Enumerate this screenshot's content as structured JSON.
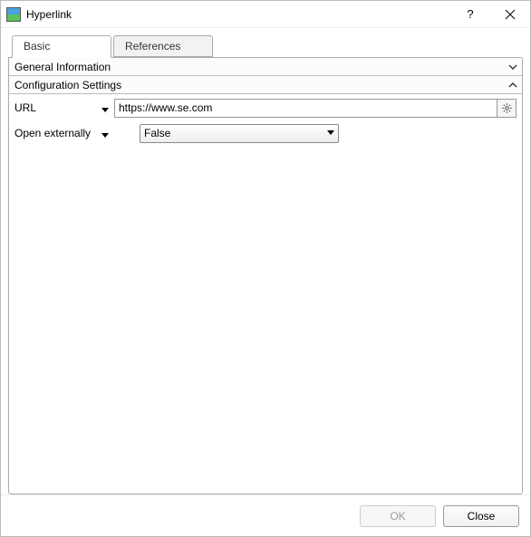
{
  "window": {
    "title": "Hyperlink"
  },
  "tabs": {
    "basic": "Basic",
    "references": "References"
  },
  "sections": {
    "general": "General Information",
    "config": "Configuration Settings"
  },
  "fields": {
    "url_label": "URL",
    "url_value": "https://www.se.com",
    "open_ext_label": "Open externally",
    "open_ext_value": "False"
  },
  "footer": {
    "ok": "OK",
    "close": "Close"
  }
}
